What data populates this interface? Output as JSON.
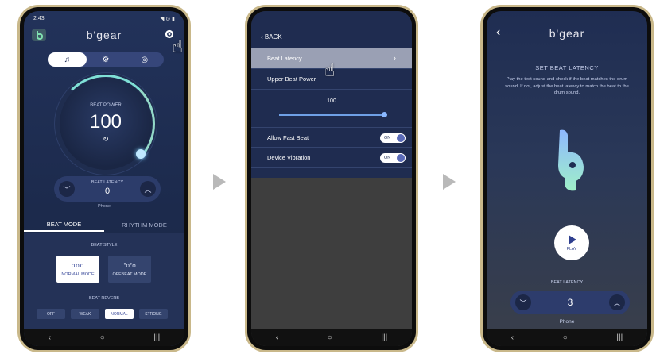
{
  "colors": {
    "accent": "#7fe0d6",
    "app_bg": "#22325a",
    "pill": "#2c3c6a",
    "selected_row": "#9aa0b4"
  },
  "phone1": {
    "status_time": "2:43",
    "status_right": "◥ ⊙ ▮",
    "logo": "b'gear",
    "mode_icons": [
      "music-note-icon",
      "gamepad-icon",
      "film-reel-icon"
    ],
    "mode_glyphs": [
      "♫",
      "⚙",
      "◎"
    ],
    "dial_label": "BEAT POWER",
    "dial_value": "100",
    "reset_glyph": "↻",
    "latency_label": "BEAT LATENCY",
    "latency_value": "0",
    "latency_device": "Phone",
    "tabs": [
      "BEAT MODE",
      "RHYTHM MODE"
    ],
    "style_label": "BEAT STYLE",
    "styles": [
      "NORMAL MODE",
      "OFFBEAT MODE"
    ],
    "reverb_label": "BEAT REVERB",
    "reverb_options": [
      "OFF",
      "WEAK",
      "NORMAL",
      "STRONG"
    ],
    "reverb_selected": "NORMAL"
  },
  "phone2": {
    "back": "‹ BACK",
    "rows": [
      "Beat Latency",
      "Upper Beat Power"
    ],
    "slider_value": "100",
    "slider_fraction": 1.0,
    "toggles": [
      {
        "label": "Allow Fast Beat",
        "state": "ON"
      },
      {
        "label": "Device Vibration",
        "state": "ON"
      }
    ],
    "chevron": "›"
  },
  "phone3": {
    "logo": "b'gear",
    "back": "‹",
    "title": "SET BEAT LATENCY",
    "instructions": "Play the test sound and check if the beat matches the drum sound. If not, adjust the beat latency to match the beat to the drum sound.",
    "play_label": "PLAY",
    "latency_label": "BEAT LATENCY",
    "latency_value": "3",
    "latency_device": "Phone"
  },
  "nav": [
    "‹",
    "○",
    "|||"
  ]
}
